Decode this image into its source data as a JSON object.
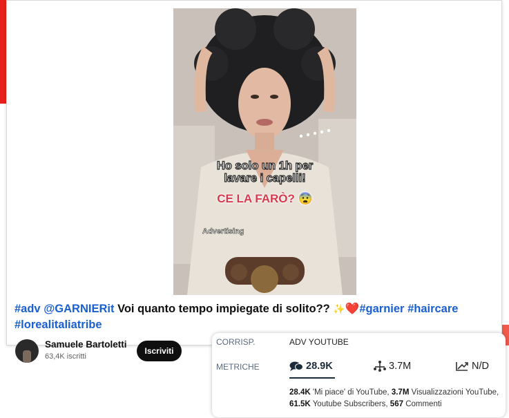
{
  "video": {
    "overlay_line1": "Ho solo un 1h per",
    "overlay_line2": "lavare i capelli!",
    "overlay_red": "CE LA FARÒ? 😨",
    "overlay_ad": "Advertising"
  },
  "caption": {
    "tag_adv": "#adv",
    "mention": "@GARNIERit",
    "text": "Voi quanto tempo impiegate di solito??",
    "sparkle": "✨",
    "heart": "❤️",
    "tag_garnier": "#garnier",
    "tag_haircare": "#haircare",
    "tag_loreal": "#lorealitaliatribe"
  },
  "channel": {
    "name": "Samuele Bartoletti",
    "subscribers": "63,4K iscritti",
    "subscribe_label": "Iscriviti"
  },
  "panel": {
    "corrisp_label": "CORRISP.",
    "corrisp_value": "ADV YOUTUBE",
    "metriche_label": "METRICHE",
    "comments": "28.9K",
    "network": "3.7M",
    "trend": "N/D",
    "detail": {
      "likes": "28.4K",
      "likes_text": "'Mi piace' di YouTube,",
      "views": "3.7M",
      "views_text": "Visualizzazioni YouTube,",
      "subs": "61.5K",
      "subs_text": "Youtube Subscribers,",
      "comments": "567",
      "comments_text": "Commenti"
    }
  },
  "colors": {
    "accent_red": "#e8201c",
    "hashtag_blue": "#1a5fd1",
    "overlay_red": "#d63a4e"
  },
  "icons": [
    "comment-bubbles-icon",
    "network-icon",
    "trend-up-icon"
  ]
}
